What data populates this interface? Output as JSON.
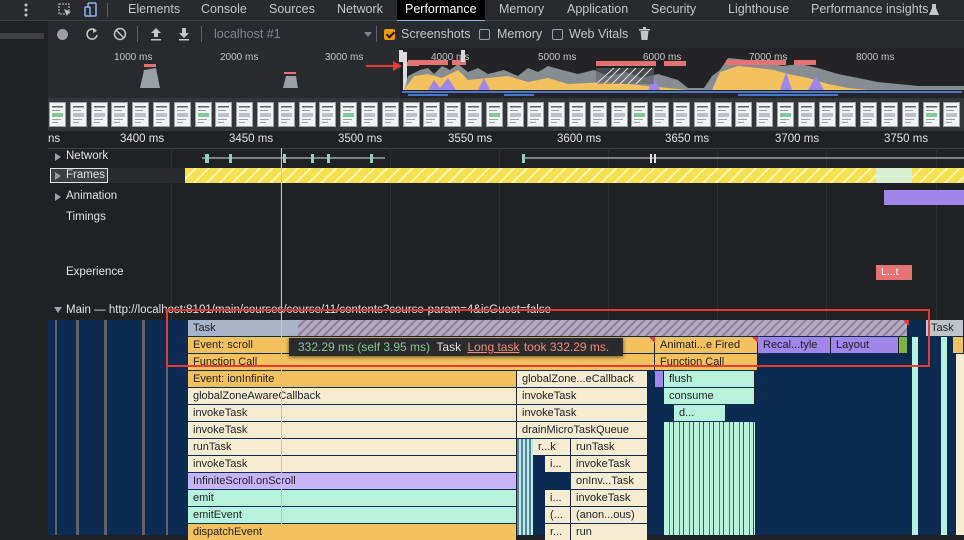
{
  "tabs": [
    "Elements",
    "Console",
    "Sources",
    "Network",
    "Performance",
    "Memory",
    "Application",
    "Security",
    "Lighthouse",
    "Performance insights"
  ],
  "toolbar": {
    "target": "localhost #1",
    "screenshots_label": "Screenshots",
    "screenshots_checked": true,
    "memory_label": "Memory",
    "memory_checked": false,
    "webvitals_label": "Web Vitals",
    "webvitals_checked": false
  },
  "overview_ticks": [
    "1000 ms",
    "2000 ms",
    "3000 ms",
    "4000 ms",
    "5000 ms",
    "6000 ms",
    "7000 ms",
    "8000 ms"
  ],
  "ruler_ticks": [
    "ns",
    "3400 ms",
    "3450 ms",
    "3500 ms",
    "3550 ms",
    "3600 ms",
    "3650 ms",
    "3700 ms",
    "3750 ms"
  ],
  "tracks": {
    "network": "Network",
    "frames": "Frames",
    "animation": "Animation",
    "timings": "Timings",
    "experience": "Experience",
    "experience_item": "L...t",
    "main": "Main — http://localhost:8101/main/courses/course/11/contents?course-param=4&isGuest=false"
  },
  "flame": {
    "task": "Task",
    "task_right": "Task",
    "event_scroll": "Event: scroll",
    "animation_fired": "Animati...e Fired",
    "recalc_style": "Recal...tyle",
    "layout": "Layout",
    "function_call": "Function Call",
    "function_call_2": "Function Call",
    "left_col": [
      "Event: ionInfinite",
      "globalZoneAwareCallback",
      "invokeTask",
      "invokeTask",
      "runTask",
      "invokeTask",
      "InfiniteScroll.onScroll",
      "emit",
      "emitEvent",
      "dispatchEvent"
    ],
    "mid_col": [
      "globalZone...eCallback",
      "invokeTask",
      "invokeTask",
      "drainMicroTaskQueue"
    ],
    "mid_small": [
      "r...k",
      "i...",
      "i...",
      "(...",
      "r..."
    ],
    "mid_right": [
      "runTask",
      "invokeTask",
      "onInv...Task",
      "invokeTask",
      "(anon...ous)",
      "run"
    ],
    "right_col": [
      "flush",
      "consume",
      "d..."
    ]
  },
  "tooltip": {
    "duration": "332.29 ms (self 3.95 ms)",
    "name": "Task",
    "link": "Long task",
    "suffix": "took 332.29 ms."
  },
  "colors": {
    "highlight_box": "#e53935",
    "frames_yellow": "#f6e04f",
    "scripting": "#f3c15e",
    "rendering": "#9f86e8"
  }
}
